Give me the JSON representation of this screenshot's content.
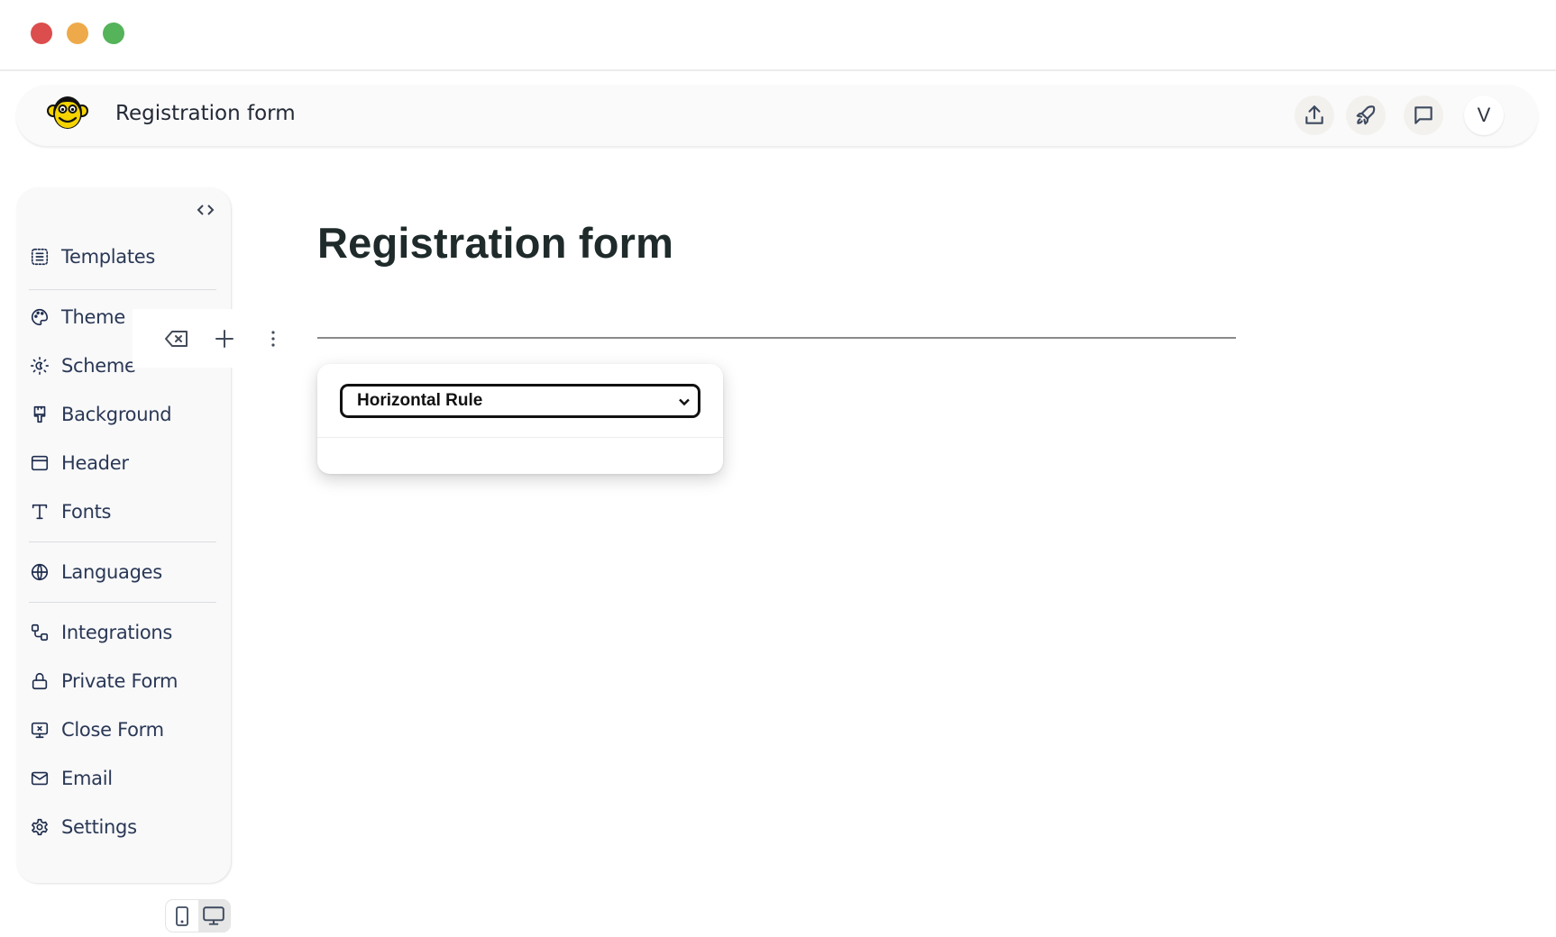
{
  "window": {
    "traffic_lights": [
      "close",
      "minimize",
      "maximize"
    ]
  },
  "header": {
    "logo_icon": "monkey-face-icon",
    "title": "Registration form",
    "actions": [
      {
        "name": "upload",
        "icon": "upload-icon"
      },
      {
        "name": "publish",
        "icon": "rocket-icon"
      },
      {
        "name": "comments",
        "icon": "comment-icon"
      }
    ],
    "avatar_initial": "V"
  },
  "sidebar": {
    "collapse_icon": "code-brackets-icon",
    "items": [
      {
        "label": "Templates",
        "icon": "template-list-icon"
      },
      {
        "label": "Theme",
        "icon": "palette-icon"
      },
      {
        "label": "Scheme",
        "icon": "sun-moon-icon"
      },
      {
        "label": "Background",
        "icon": "paint-brush-icon"
      },
      {
        "label": "Header",
        "icon": "window-header-icon"
      },
      {
        "label": "Fonts",
        "icon": "type-icon"
      },
      {
        "label": "Languages",
        "icon": "globe-icon"
      },
      {
        "label": "Integrations",
        "icon": "integrations-icon"
      },
      {
        "label": "Private Form",
        "icon": "lock-icon"
      },
      {
        "label": "Close Form",
        "icon": "screen-close-icon"
      },
      {
        "label": "Email",
        "icon": "mail-icon"
      },
      {
        "label": "Settings",
        "icon": "gear-icon"
      }
    ]
  },
  "block_toolbar": {
    "actions": [
      "delete-block",
      "add-block",
      "more-options"
    ]
  },
  "main": {
    "form_title": "Registration form",
    "block_type_select": {
      "value": "Horizontal Rule"
    }
  },
  "device_toggle": {
    "options": [
      "mobile",
      "desktop"
    ],
    "active": "desktop"
  },
  "colors": {
    "traffic_red": "#dc4d4d",
    "traffic_yellow": "#eeaa4a",
    "traffic_green": "#55b359",
    "sidebar_text": "#2a3855",
    "title_text": "#1f2a2a",
    "logo_yellow": "#f5d400"
  }
}
